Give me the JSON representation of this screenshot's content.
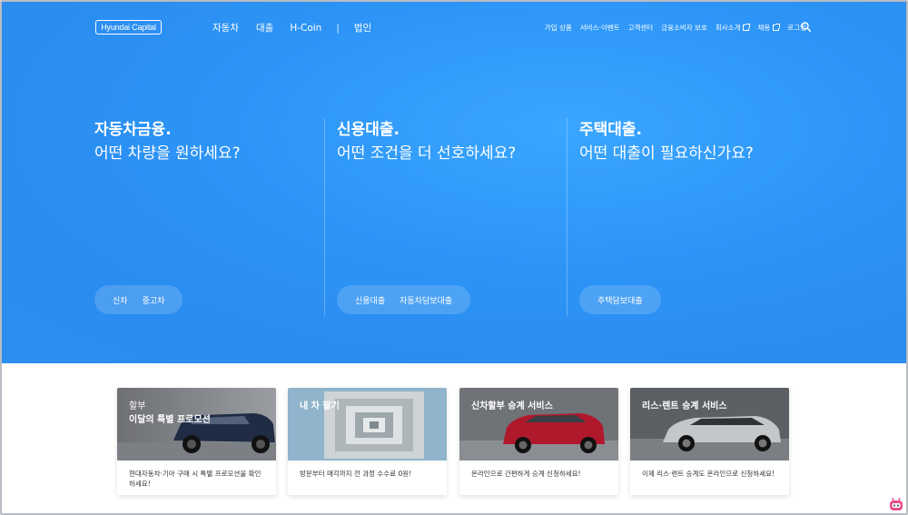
{
  "header": {
    "logo": "Hyundai Capital",
    "nav_main": [
      "자동차",
      "대출",
      "H-Coin",
      "|",
      "법인"
    ],
    "nav_util": [
      {
        "label": "가입 상품",
        "ext": false
      },
      {
        "label": "서비스·이벤트",
        "ext": false
      },
      {
        "label": "고객센터",
        "ext": false
      },
      {
        "label": "금융소비자 보호",
        "ext": false
      },
      {
        "label": "회사소개",
        "ext": true
      },
      {
        "label": "채용",
        "ext": true
      },
      {
        "label": "로그인",
        "ext": false
      }
    ]
  },
  "hero": {
    "columns": [
      {
        "title": "자동차금융.",
        "subtitle": "어떤 차량을 원하세요?",
        "buttons": [
          "신차",
          "중고차"
        ]
      },
      {
        "title": "신용대출.",
        "subtitle": "어떤 조건을 더 선호하세요?",
        "buttons": [
          "신용대출",
          "자동차담보대출"
        ]
      },
      {
        "title": "주택대출.",
        "subtitle": "어떤 대출이 필요하신가요?",
        "buttons": [
          "주택담보대출"
        ]
      }
    ]
  },
  "cards": [
    {
      "caption_sub": "할부",
      "caption": "이달의 특별 프로모션",
      "desc": "현대자동차·기아 구매 시 특별 프로모션을 확인하세요!"
    },
    {
      "caption_sub": "",
      "caption": "내 차 팔기",
      "desc": "방문부터 매각까지 전 과정 수수료 0원!"
    },
    {
      "caption_sub": "",
      "caption": "신차할부 승계 서비스",
      "desc": "온라인으로 간편하게 승계 신청하세요!"
    },
    {
      "caption_sub": "",
      "caption": "리스·렌트 승계 서비스",
      "desc": "이제 리스·렌트 승계도 온라인으로 신청하세요!"
    }
  ],
  "colors": {
    "hero_blue": "#2d95f7",
    "card_text": "#333333",
    "frame_border": "#b9bcc2"
  }
}
